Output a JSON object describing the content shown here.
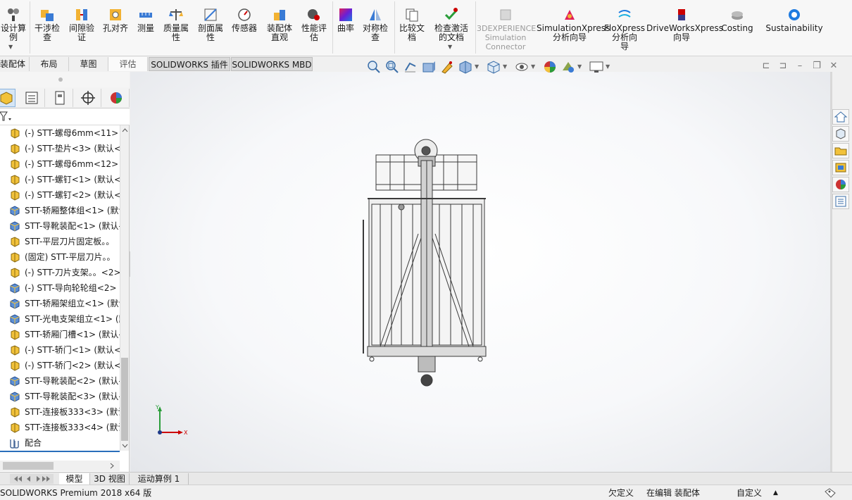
{
  "ribbon": {
    "buttons": [
      {
        "key": "design-study",
        "label": "设计算\n例"
      },
      {
        "key": "interference",
        "label": "干涉检\n查"
      },
      {
        "key": "clearance",
        "label": "间隙验\n证"
      },
      {
        "key": "hole-align",
        "label": "孔对齐"
      },
      {
        "key": "measure",
        "label": "测量"
      },
      {
        "key": "mass-props",
        "label": "质量属\n性"
      },
      {
        "key": "section-props",
        "label": "剖面属\n性"
      },
      {
        "key": "sensor",
        "label": "传感器"
      },
      {
        "key": "asm-visual",
        "label": "装配体\n直观"
      },
      {
        "key": "perf-eval",
        "label": "性能评\n估"
      },
      {
        "key": "curvature",
        "label": "曲率"
      },
      {
        "key": "symmetry",
        "label": "对称检\n查"
      },
      {
        "key": "compare-docs",
        "label": "比较文\n档"
      },
      {
        "key": "check-active",
        "label": "检查激活\n的文档"
      },
      {
        "key": "3dx-sim",
        "label": "3DEXPERIENCE\nSimulation\nConnector"
      },
      {
        "key": "simxpress",
        "label": "SimulationXpress\n分析向导"
      },
      {
        "key": "floxpress",
        "label": "FloXpress\n分析向\n导"
      },
      {
        "key": "driveworks",
        "label": "DriveWorksXpress\n向导"
      },
      {
        "key": "costing",
        "label": "Costing"
      },
      {
        "key": "sustainability",
        "label": "Sustainability"
      }
    ]
  },
  "tabs": [
    "装配体",
    "布局",
    "草图",
    "评估",
    "SOLIDWORKS 插件",
    "SOLIDWORKS MBD"
  ],
  "tree": {
    "items": [
      {
        "label": "(-) STT-螺母6mm<11> (",
        "type": "part"
      },
      {
        "label": "(-) STT-垫片<3> (默认<",
        "type": "part"
      },
      {
        "label": "(-) STT-螺母6mm<12> (",
        "type": "part"
      },
      {
        "label": "(-) STT-螺钉<1> (默认<",
        "type": "part"
      },
      {
        "label": "(-) STT-螺钉<2> (默认<",
        "type": "part"
      },
      {
        "label": "STT-轿厢整体组<1> (默认",
        "type": "asm"
      },
      {
        "label": "STT-导靴装配<1> (默认-",
        "type": "asm"
      },
      {
        "label": "STT-平层刀片固定板。。",
        "type": "part"
      },
      {
        "label": "(固定) STT-平层刀片。。",
        "type": "part"
      },
      {
        "label": "(-) STT-刀片支架。。<2>",
        "type": "part"
      },
      {
        "label": "(-) STT-导向轮轮组<2> (",
        "type": "asm"
      },
      {
        "label": "STT-轿厢架组立<1> (默认",
        "type": "asm"
      },
      {
        "label": "STT-光电支架组立<1> (默",
        "type": "asm"
      },
      {
        "label": "STT-轿厢门槽<1> (默认-",
        "type": "part"
      },
      {
        "label": "(-) STT-轿门<1> (默认<",
        "type": "part"
      },
      {
        "label": "(-) STT-轿门<2> (默认<",
        "type": "part"
      },
      {
        "label": "STT-导靴装配<2> (默认-",
        "type": "asm"
      },
      {
        "label": "STT-导靴装配<3> (默认-",
        "type": "asm"
      },
      {
        "label": "STT-连接板333<3> (默认",
        "type": "part"
      },
      {
        "label": "STT-连接板333<4> (默认",
        "type": "part"
      },
      {
        "label": "配合",
        "type": "mate"
      }
    ]
  },
  "bottom_tabs": [
    "模型",
    "3D 视图",
    "运动算例 1"
  ],
  "status": {
    "app": "SOLIDWORKS Premium 2018 x64 版",
    "define": "欠定义",
    "editing": "在编辑 装配体",
    "custom": "自定义"
  },
  "triad": {
    "y": "Y",
    "x": "X"
  },
  "colors": {
    "accent": "#2a6ebb",
    "ribbon_bg": "#f7f7f7",
    "part_icon": "#f2c23a",
    "asm_icon": "#5b8fd6"
  }
}
